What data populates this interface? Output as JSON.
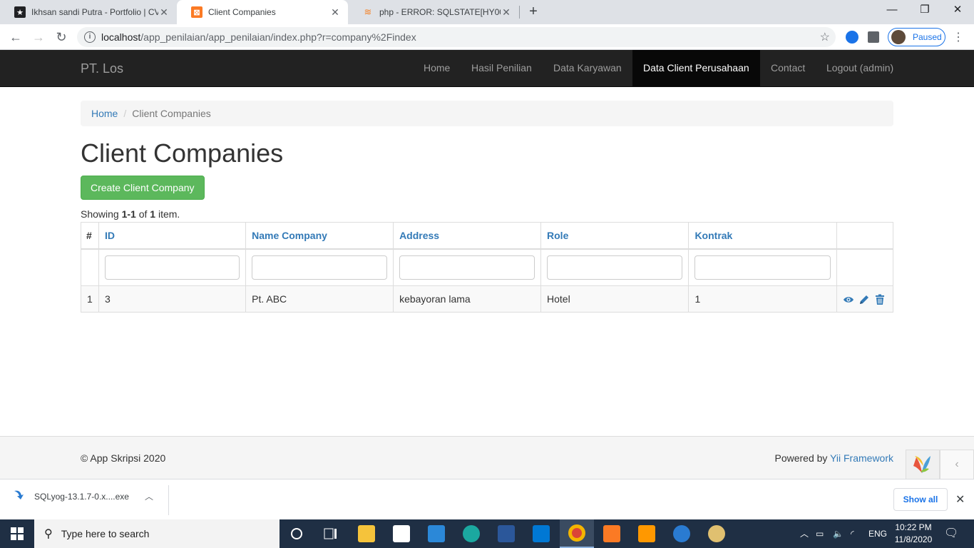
{
  "browser": {
    "tabs": [
      {
        "title": "Ikhsan sandi Putra - Portfolio | CV",
        "active": false
      },
      {
        "title": "Client Companies",
        "active": true
      },
      {
        "title": "php - ERROR: SQLSTATE[HY000] [",
        "active": false
      }
    ],
    "url_host": "localhost",
    "url_path": "/app_penilaian/app_penilaian/index.php?r=company%2Findex",
    "profile_status": "Paused"
  },
  "navbar": {
    "brand": "PT. Los",
    "items": [
      {
        "label": "Home",
        "active": false
      },
      {
        "label": "Hasil Penilian",
        "active": false
      },
      {
        "label": "Data Karyawan",
        "active": false
      },
      {
        "label": "Data Client Perusahaan",
        "active": true
      },
      {
        "label": "Contact",
        "active": false
      },
      {
        "label": "Logout (admin)",
        "active": false
      }
    ]
  },
  "breadcrumb": {
    "home": "Home",
    "current": "Client Companies"
  },
  "page": {
    "title": "Client Companies",
    "create_button": "Create Client Company",
    "summary_prefix": "Showing ",
    "summary_range": "1-1",
    "summary_of": " of ",
    "summary_total": "1",
    "summary_suffix": " item."
  },
  "grid": {
    "columns": [
      "#",
      "ID",
      "Name Company",
      "Address",
      "Role",
      "Kontrak"
    ],
    "rows": [
      {
        "num": "1",
        "id": "3",
        "name": "Pt. ABC",
        "address": "kebayoran lama",
        "role": "Hotel",
        "kontrak": "1"
      }
    ]
  },
  "footer": {
    "copyright": "© App Skripsi 2020",
    "powered_prefix": "Powered by ",
    "powered_link": "Yii Framework"
  },
  "downloads": {
    "file": "SQLyog-13.1.7-0.x....exe",
    "show_all": "Show all"
  },
  "taskbar": {
    "search_placeholder": "Type here to search",
    "language": "ENG",
    "time": "10:22 PM",
    "date": "11/8/2020"
  },
  "colors": {
    "link": "#337ab7",
    "success": "#5cb85c",
    "navbar": "#222222"
  }
}
